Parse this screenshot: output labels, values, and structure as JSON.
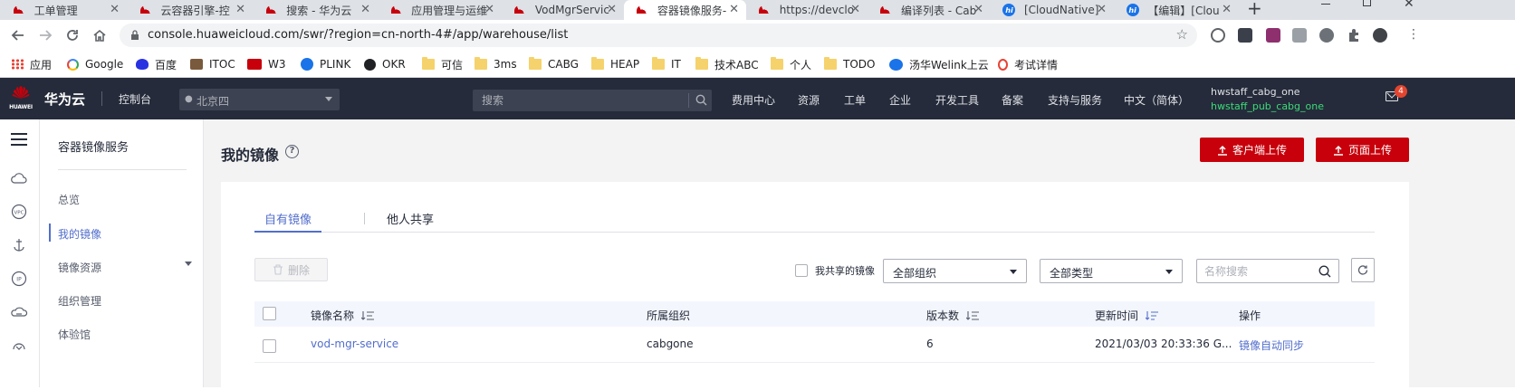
{
  "browser": {
    "tabs": [
      {
        "label": "工单管理",
        "icon": "huawei-icon",
        "active": false
      },
      {
        "label": "云容器引擎-控",
        "icon": "huawei-icon",
        "active": false
      },
      {
        "label": "搜索 - 华为云",
        "icon": "huawei-icon",
        "active": false
      },
      {
        "label": "应用管理与运维",
        "icon": "huawei-icon",
        "active": false
      },
      {
        "label": "VodMgrServic",
        "icon": "huawei-icon",
        "active": false
      },
      {
        "label": "容器镜像服务-",
        "icon": "huawei-icon",
        "active": true
      },
      {
        "label": "https://devclo",
        "icon": "huawei-icon",
        "active": false
      },
      {
        "label": "编译列表 - Cab",
        "icon": "huawei-icon",
        "active": false
      },
      {
        "label": "[CloudNative]",
        "icon": "hi-icon",
        "active": false
      },
      {
        "label": "【编辑】[Clou",
        "icon": "hi-icon",
        "active": false
      }
    ],
    "new_tab_label": "+",
    "url": "console.huaweicloud.com/swr/?region=cn-north-4#/app/warehouse/list",
    "bookmarks": [
      {
        "label": "应用",
        "icon": "apps-icon"
      },
      {
        "label": "Google",
        "icon": "google-icon"
      },
      {
        "label": "百度",
        "icon": "baidu-icon"
      },
      {
        "label": "ITOC",
        "icon": "itoc-icon"
      },
      {
        "label": "W3",
        "icon": "w3-icon"
      },
      {
        "label": "PLINK",
        "icon": "plink-icon"
      },
      {
        "label": "OKR",
        "icon": "okr-icon"
      },
      {
        "label": "可信",
        "icon": "folder-icon"
      },
      {
        "label": "3ms",
        "icon": "folder-icon"
      },
      {
        "label": "CABG",
        "icon": "folder-icon"
      },
      {
        "label": "HEAP",
        "icon": "folder-icon"
      },
      {
        "label": "IT",
        "icon": "folder-icon"
      },
      {
        "label": "技术ABC",
        "icon": "folder-icon"
      },
      {
        "label": "个人",
        "icon": "folder-icon"
      },
      {
        "label": "TODO",
        "icon": "folder-icon"
      },
      {
        "label": "汤华Welink上云",
        "icon": "welink-icon"
      },
      {
        "label": "考试详情",
        "icon": "exam-icon"
      }
    ]
  },
  "header": {
    "logo_text": "HUAWEI",
    "brand": "华为云",
    "console": "控制台",
    "region": "北京四",
    "search_placeholder": "搜索",
    "nav": [
      "费用中心",
      "资源",
      "工单",
      "企业",
      "开发工具",
      "备案",
      "支持与服务",
      "中文（简体）"
    ],
    "account_main": "hwstaff_cabg_one",
    "account_sub": "hwstaff_pub_cabg_one",
    "mail_count": "4"
  },
  "sidebar": {
    "title": "容器镜像服务",
    "items": [
      {
        "label": "总览",
        "active": false
      },
      {
        "label": "我的镜像",
        "active": true
      },
      {
        "label": "镜像资源",
        "active": false
      },
      {
        "label": "组织管理",
        "active": false
      },
      {
        "label": "体验馆",
        "active": false
      }
    ]
  },
  "main": {
    "title": "我的镜像",
    "client_upload": "客户端上传",
    "page_upload": "页面上传",
    "tabs": [
      "自有镜像",
      "他人共享"
    ],
    "delete_label": "删除",
    "shared_label": "我共享的镜像",
    "org_select": "全部组织",
    "type_select": "全部类型",
    "name_search_placeholder": "名称搜索",
    "table": {
      "headers": [
        "镜像名称",
        "所属组织",
        "版本数",
        "更新时间",
        "操作"
      ],
      "rows": [
        {
          "name": "vod-mgr-service",
          "org": "cabgone",
          "versions": "6",
          "updated": "2021/03/03 20:33:36 G...",
          "action": "镜像自动同步"
        }
      ]
    }
  },
  "colors": {
    "brand_red": "#c7000b",
    "link_blue": "#526ecc",
    "header_bg": "#252b3a",
    "account_green": "#3cdb7a"
  }
}
